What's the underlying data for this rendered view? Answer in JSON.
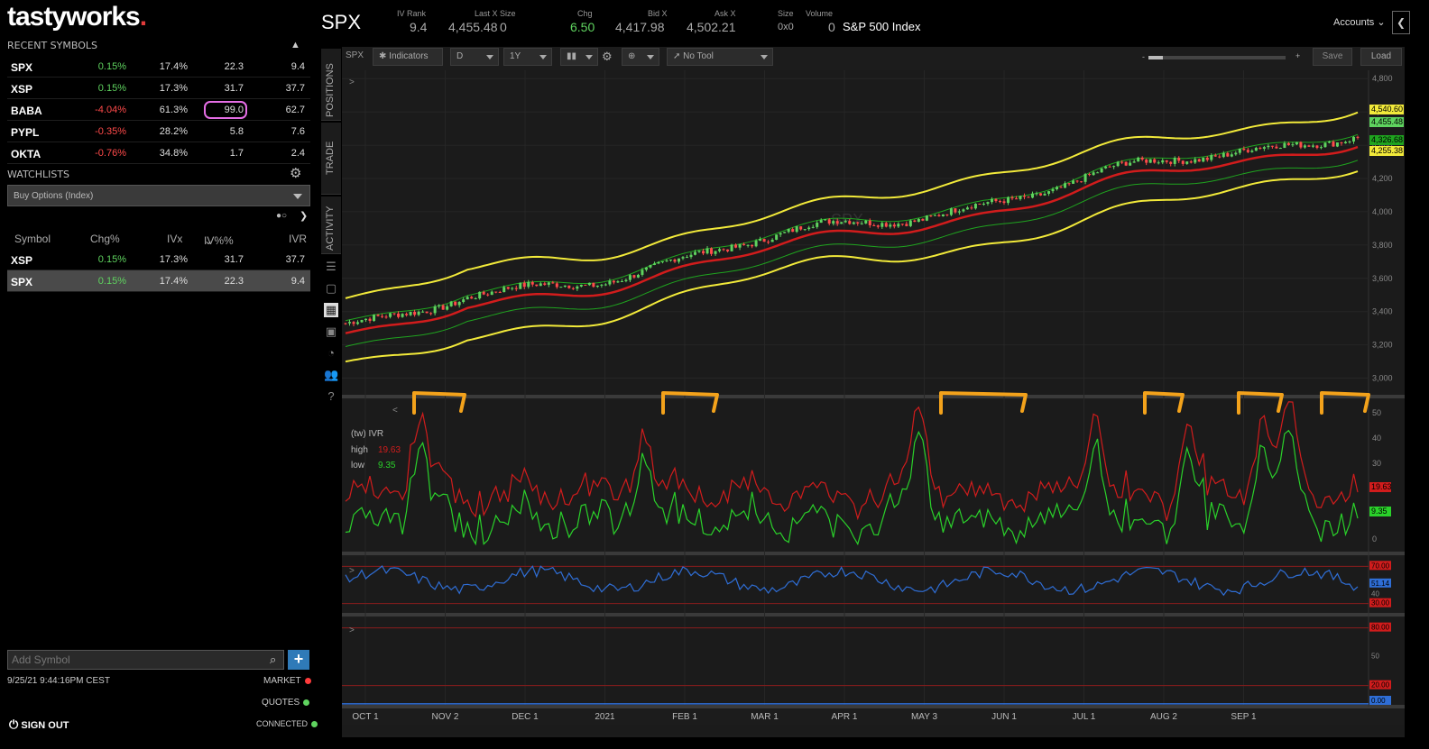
{
  "app": {
    "logo": "tastyworks",
    "logo_dot": "."
  },
  "header": {
    "symbol": "SPX",
    "iv_rank_label": "IV Rank",
    "iv_rank": "9.4",
    "last_label": "Last X Size",
    "last": "4,455.48",
    "last_size": "0",
    "chg_label": "Chg",
    "chg": "6.50",
    "bid_label": "Bid X",
    "bid": "4,417.98",
    "ask_label": "Ask X",
    "ask": "4,502.21",
    "size_label": "Size",
    "size": "0x0",
    "volume_label": "Volume",
    "volume": "0",
    "description": "S&P 500 Index",
    "accounts": "Accounts"
  },
  "recent": {
    "title": "RECENT SYMBOLS",
    "rows": [
      {
        "symbol": "SPX",
        "chg": "0.15%",
        "ivx": "17.4%",
        "ivp": "22.3",
        "ivr": "9.4",
        "dir": "up"
      },
      {
        "symbol": "XSP",
        "chg": "0.15%",
        "ivx": "17.3%",
        "ivp": "31.7",
        "ivr": "37.7",
        "dir": "up"
      },
      {
        "symbol": "BABA",
        "chg": "-4.04%",
        "ivx": "61.3%",
        "ivp": "99.0",
        "ivr": "62.7",
        "dir": "down"
      },
      {
        "symbol": "PYPL",
        "chg": "-0.35%",
        "ivx": "28.2%",
        "ivp": "5.8",
        "ivr": "7.6",
        "dir": "down"
      },
      {
        "symbol": "OKTA",
        "chg": "-0.76%",
        "ivx": "34.8%",
        "ivp": "1.7",
        "ivr": "2.4",
        "dir": "down"
      }
    ]
  },
  "watchlists": {
    "title": "WATCHLISTS",
    "selected": "Buy Options (Index)",
    "headers": {
      "symbol": "Symbol",
      "chg": "Chg%",
      "ivx": "IVx",
      "ivp": "IV%%",
      "ivr": "IVR"
    },
    "rows": [
      {
        "symbol": "XSP",
        "chg": "0.15%",
        "ivx": "17.3%",
        "ivp": "31.7",
        "ivr": "37.7"
      },
      {
        "symbol": "SPX",
        "chg": "0.15%",
        "ivx": "17.4%",
        "ivp": "22.3",
        "ivr": "9.4"
      }
    ]
  },
  "footer": {
    "add_placeholder": "Add Symbol",
    "datetime": "9/25/21 9:44:16PM CEST",
    "market": "MARKET",
    "quotes": "QUOTES",
    "connected": "CONNECTED",
    "sign_out": "SIGN OUT"
  },
  "side_tabs": [
    "POSITIONS",
    "TRADE",
    "ACTIVITY"
  ],
  "toolbar": {
    "symbol": "SPX",
    "indicators": "Indicators",
    "interval": "D",
    "range": "1Y",
    "tool": "No Tool",
    "save": "Save",
    "load": "Load"
  },
  "colors": {
    "up": "#5fd35f",
    "down": "#ff4a4a",
    "bands": "#f2ea3a",
    "ma_red": "#d11c1c",
    "ma_green": "#1fa41f",
    "ivr_high": "#d11c1c",
    "ivr_low": "#2ad12a",
    "rsi": "#2f6ed6",
    "annotation": "#f3a21b",
    "highlight": "#e56ee5"
  },
  "chart_data": [
    {
      "type": "line",
      "title": "SPX",
      "x_ticks": [
        "OCT 1",
        "NOV 2",
        "DEC 1",
        "2021",
        "FEB 1",
        "MAR 1",
        "APR 1",
        "MAY 3",
        "JUN 1",
        "JUL 1",
        "AUG 2",
        "SEP 1"
      ],
      "y_ticks": [
        "4,800",
        "4,600",
        "4,400",
        "4,200",
        "4,000",
        "3,800",
        "3,600",
        "3,400",
        "3,200",
        "3,000"
      ],
      "ylim": [
        2900,
        4850
      ],
      "price_labels": [
        "4,540.60",
        "4,455.48",
        "4,326.68",
        "4,255.38"
      ],
      "price_label_colors": [
        "#f2ea3a",
        "#5fd35f",
        "#1fa41f",
        "#f2ea3a"
      ],
      "watermark": "SPX"
    },
    {
      "type": "line",
      "title": "(tw) IVR",
      "legend": {
        "high_label": "high",
        "high": "19.63",
        "low_label": "low",
        "low": "9.35"
      },
      "y_ticks": [
        "50",
        "40",
        "30",
        "20",
        "10",
        "0"
      ],
      "ylim": [
        -5,
        55
      ],
      "last_labels": [
        "19.63",
        "9.35"
      ]
    },
    {
      "type": "line",
      "y_ticks": [
        "70.00",
        "51.14",
        "40",
        "30.00"
      ],
      "ylim": [
        20,
        80
      ]
    },
    {
      "type": "line",
      "y_ticks": [
        "80.00",
        "50",
        "20.00",
        "0.00"
      ],
      "ylim": [
        0,
        90
      ]
    }
  ]
}
